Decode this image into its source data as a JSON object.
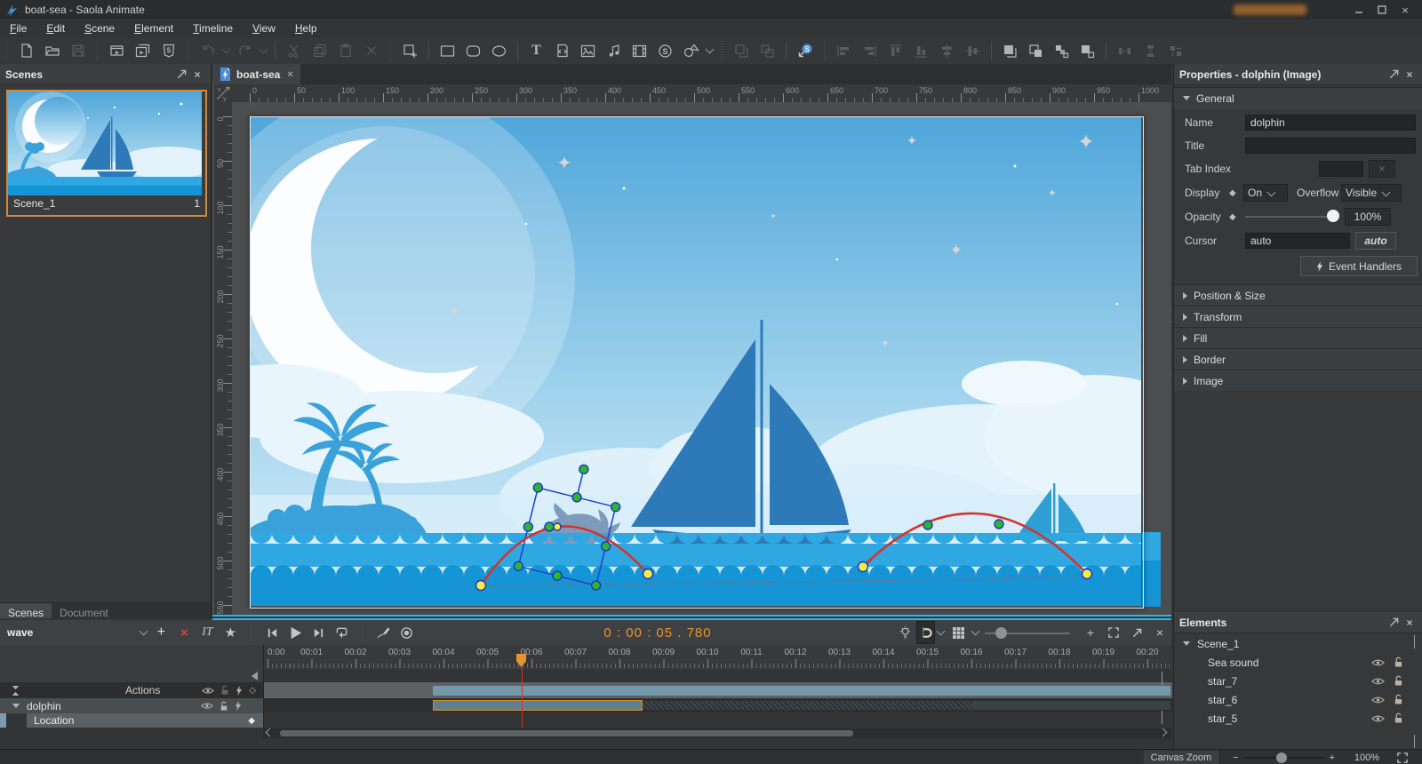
{
  "window": {
    "title": "boat-sea - Saola Animate"
  },
  "menu": [
    "File",
    "Edit",
    "Scene",
    "Element",
    "Timeline",
    "View",
    "Help"
  ],
  "scenes": {
    "title": "Scenes",
    "scene_name": "Scene_1",
    "scene_badge": "1",
    "tab_scenes": "Scenes",
    "tab_document": "Document"
  },
  "canvas": {
    "tab_title": "boat-sea",
    "h_ruler": [
      "0",
      "50",
      "100",
      "150",
      "200",
      "250",
      "300",
      "350",
      "400",
      "450",
      "500",
      "550",
      "600",
      "650",
      "700",
      "750",
      "800",
      "850",
      "900",
      "950",
      "1000"
    ],
    "v_ruler": [
      "0",
      "50",
      "100",
      "150",
      "200",
      "250",
      "300",
      "350",
      "400",
      "450",
      "500",
      "550"
    ]
  },
  "properties": {
    "title": "Properties - dolphin (Image)",
    "general": {
      "header": "General",
      "name_label": "Name",
      "name_value": "dolphin",
      "title_label": "Title",
      "title_value": "",
      "tabindex_label": "Tab Index",
      "display_label": "Display",
      "display_value": "On",
      "overflow_label": "Overflow",
      "overflow_value": "Visible",
      "opacity_label": "Opacity",
      "opacity_value": "100%",
      "cursor_label": "Cursor",
      "cursor_value": "auto",
      "cursor_auto_button": "auto",
      "event_handlers_label": "Event Handlers"
    },
    "sections": [
      "Position & Size",
      "Transform",
      "Fill",
      "Border",
      "Image"
    ]
  },
  "elements": {
    "title": "Elements",
    "root": "Scene_1",
    "items": [
      "Sea sound",
      "star_7",
      "star_6",
      "star_5"
    ]
  },
  "timeline": {
    "animation_name": "wave",
    "rename_label": "IT",
    "time_display": "0 : 00 : 05 . 780",
    "actions_label": "Actions",
    "dolphin_label": "dolphin",
    "location_label": "Location",
    "ruler": [
      "0:00",
      "00:01",
      "00:02",
      "00:03",
      "00:04",
      "00:05",
      "00:06",
      "00:07",
      "00:08",
      "00:09",
      "00:10",
      "00:11",
      "00:12",
      "00:13",
      "00:14",
      "00:15",
      "00:16",
      "00:17",
      "00:18",
      "00:19",
      "00:20"
    ]
  },
  "statusbar": {
    "zoom_label": "Canvas Zoom",
    "zoom_value": "100%"
  },
  "icons": {
    "close": "×",
    "plus": "+",
    "minus": "−",
    "star": "★",
    "diamond_filled": "◆",
    "diamond_outline": "◇",
    "left_triangle": "◀",
    "text_tool": "T",
    "html5": "5",
    "symbol_s": "S",
    "corner_x": "x",
    "corner_y": "y"
  },
  "colors": {
    "accent_orange": "#e8932e",
    "selection_blue": "#2040d0",
    "handle_green": "#2db52d",
    "keyframe_yellow": "#f5ee3e",
    "path_red": "#d5342b",
    "sea_blue": "#2fa7e0",
    "boat_blue": "#2e7ab8",
    "timeline_bar": "#7397ab"
  }
}
